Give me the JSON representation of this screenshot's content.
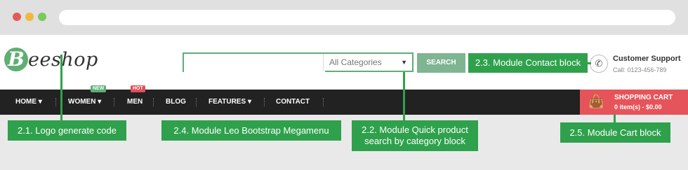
{
  "browser": {
    "controls": [
      "close",
      "minimize",
      "maximize"
    ]
  },
  "logo": {
    "mark": "B",
    "text": "eeshop"
  },
  "search": {
    "placeholder": "",
    "category": "All Categories",
    "button": "SEARCH",
    "caret_icon": "chevron-down-icon"
  },
  "support": {
    "title": "Customer Support",
    "phone": "Call: 0123-456-789",
    "icon": "phone-icon"
  },
  "nav": {
    "items": [
      {
        "label": "HOME",
        "caret": "▾"
      },
      {
        "label": "WOMEN",
        "caret": "▾",
        "badge": "NEW"
      },
      {
        "label": "MEN",
        "badge": "HOT"
      },
      {
        "label": "BLOG"
      },
      {
        "label": "FEATURES",
        "caret": "▾"
      },
      {
        "label": "CONTACT"
      }
    ]
  },
  "cart": {
    "title": "SHOPPING CART",
    "count": "0 item(s) - $0.00",
    "icon": "shopping-bag-icon"
  },
  "callouts": {
    "logo": "2.1. Logo generate code",
    "megamenu": "2.4. Module Leo Bootstrap Megamenu",
    "quick_search": [
      "2.2. Module Quick product",
      "search by category block"
    ],
    "contact": "2.3. Module Contact block",
    "cart": "2.5. Module Cart block"
  },
  "colors": {
    "accent": "#5fae74",
    "callout": "#2fa14c",
    "nav_bg": "#222222",
    "cart_bg": "#e5545a",
    "hot_badge": "#e04f5a"
  }
}
